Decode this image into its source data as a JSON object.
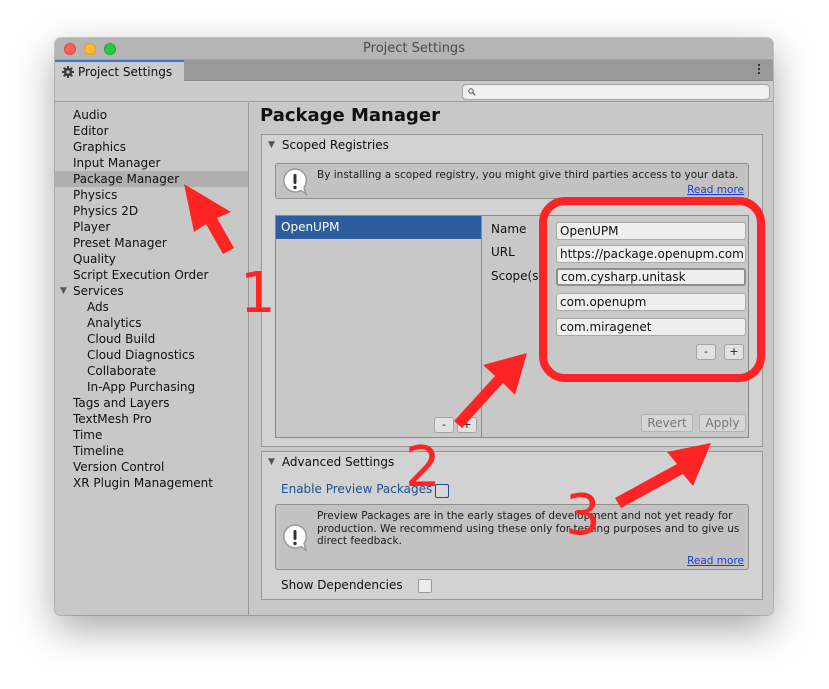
{
  "window": {
    "title": "Project Settings",
    "tab_label": "Project Settings",
    "tab_icon": "gear-icon",
    "menu_icon": "kebab-menu-icon",
    "search": {
      "value": "",
      "icon": "search-icon"
    }
  },
  "sidebar": {
    "items": [
      {
        "label": "Audio",
        "level": 0
      },
      {
        "label": "Editor",
        "level": 0
      },
      {
        "label": "Graphics",
        "level": 0
      },
      {
        "label": "Input Manager",
        "level": 0
      },
      {
        "label": "Package Manager",
        "level": 0,
        "selected": true
      },
      {
        "label": "Physics",
        "level": 0
      },
      {
        "label": "Physics 2D",
        "level": 0
      },
      {
        "label": "Player",
        "level": 0
      },
      {
        "label": "Preset Manager",
        "level": 0
      },
      {
        "label": "Quality",
        "level": 0
      },
      {
        "label": "Script Execution Order",
        "level": 0
      },
      {
        "label": "Services",
        "level": 0,
        "expanded": true
      },
      {
        "label": "Ads",
        "level": 1
      },
      {
        "label": "Analytics",
        "level": 1
      },
      {
        "label": "Cloud Build",
        "level": 1
      },
      {
        "label": "Cloud Diagnostics",
        "level": 1
      },
      {
        "label": "Collaborate",
        "level": 1
      },
      {
        "label": "In-App Purchasing",
        "level": 1
      },
      {
        "label": "Tags and Layers",
        "level": 0
      },
      {
        "label": "TextMesh Pro",
        "level": 0
      },
      {
        "label": "Time",
        "level": 0
      },
      {
        "label": "Timeline",
        "level": 0
      },
      {
        "label": "Version Control",
        "level": 0
      },
      {
        "label": "XR Plugin Management",
        "level": 0
      }
    ]
  },
  "main": {
    "title": "Package Manager",
    "scoped_registries": {
      "header": "Scoped Registries",
      "help_text": "By installing a scoped registry, you might give third parties access to your data.",
      "read_more": "Read more",
      "registries": [
        "OpenUPM"
      ],
      "list_remove": "-",
      "list_add": "+",
      "form": {
        "name_label": "Name",
        "url_label": "URL",
        "scopes_label": "Scope(s)",
        "name_value": "OpenUPM",
        "url_value": "https://package.openupm.com",
        "scopes": [
          "com.cysharp.unitask",
          "com.openupm",
          "com.miragenet"
        ],
        "scope_remove": "-",
        "scope_add": "+"
      },
      "revert_label": "Revert",
      "apply_label": "Apply"
    },
    "advanced_settings": {
      "header": "Advanced Settings",
      "enable_preview_label": "Enable Preview Packages",
      "enable_preview_checked": false,
      "help_text": "Preview Packages are in the early stages of development and not yet ready for production. We recommend using these only for testing purposes and to give us direct feedback.",
      "read_more": "Read more",
      "show_dependencies_label": "Show Dependencies",
      "show_dependencies_checked": false
    }
  },
  "annotations": {
    "color": "#ff2424",
    "numbers": [
      "1",
      "2",
      "3"
    ]
  }
}
